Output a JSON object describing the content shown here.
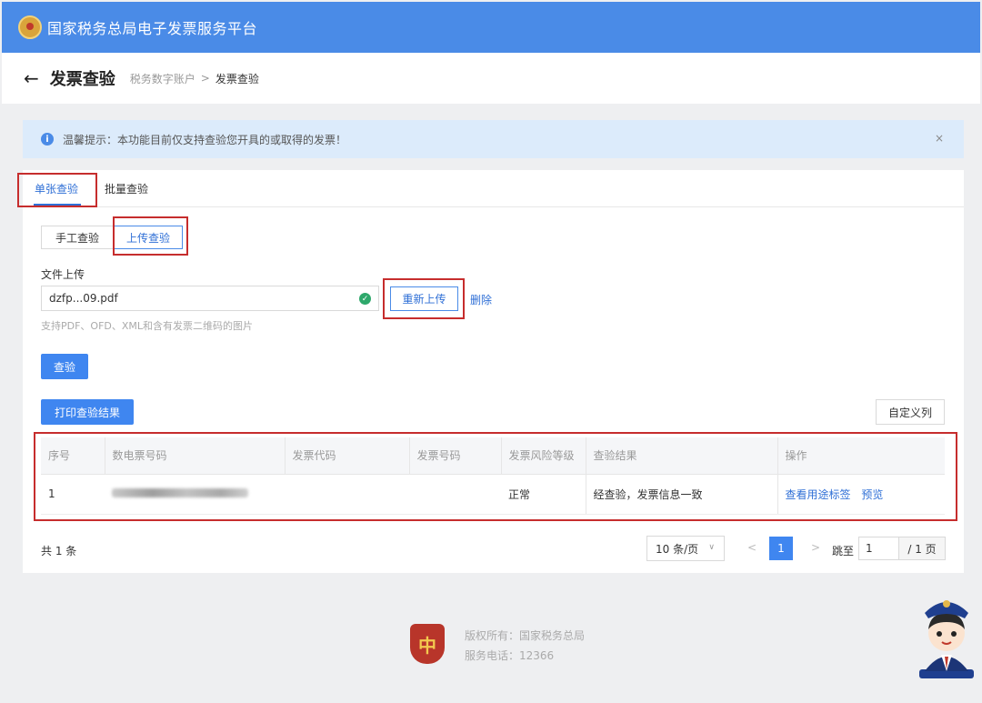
{
  "topbar": {
    "title": "国家税务总局电子发票服务平台"
  },
  "subheader": {
    "page_title": "发票查验",
    "breadcrumb_parent": "税务数字账户",
    "breadcrumb_sep": ">",
    "breadcrumb_current": "发票查验"
  },
  "notice": {
    "text": "温馨提示：本功能目前仅支持查验您开具的或取得的发票！",
    "close": "×",
    "info": "i"
  },
  "tabs": [
    {
      "label": "单张查验",
      "active": true
    },
    {
      "label": "批量查验",
      "active": false
    }
  ],
  "modes": [
    {
      "label": "手工查验",
      "active": false
    },
    {
      "label": "上传查验",
      "active": true
    }
  ],
  "upload": {
    "label": "文件上传",
    "file_name": "dzfp...09.pdf",
    "reupload_label": "重新上传",
    "delete_label": "删除",
    "hint": "支持PDF、OFD、XML和含有发票二维码的图片"
  },
  "actions": {
    "verify": "查验",
    "print": "打印查验结果",
    "customize_columns": "自定义列"
  },
  "table": {
    "columns": [
      "序号",
      "数电票号码",
      "发票代码",
      "发票号码",
      "发票风险等级",
      "查验结果",
      "操作"
    ],
    "rows": [
      {
        "index": "1",
        "invoice_no": "",
        "code": "",
        "number": "",
        "risk": "正常",
        "result": "经查验，发票信息一致",
        "op1": "查看用途标签",
        "op2": "预览"
      }
    ]
  },
  "pagination": {
    "total": "共 1 条",
    "page_size": "10 条/页",
    "current": "1",
    "jump_label": "跳至",
    "jump_value": "1",
    "page_total": "/ 1 页",
    "prev": "<",
    "next": ">"
  },
  "footer": {
    "copyright": "版权所有：国家税务总局",
    "phone": "服务电话：12366",
    "logo_char": "中"
  },
  "colors": {
    "topbar": "#4a8be7",
    "primary": "#3f86f0",
    "highlight_box": "#c62d2d"
  }
}
